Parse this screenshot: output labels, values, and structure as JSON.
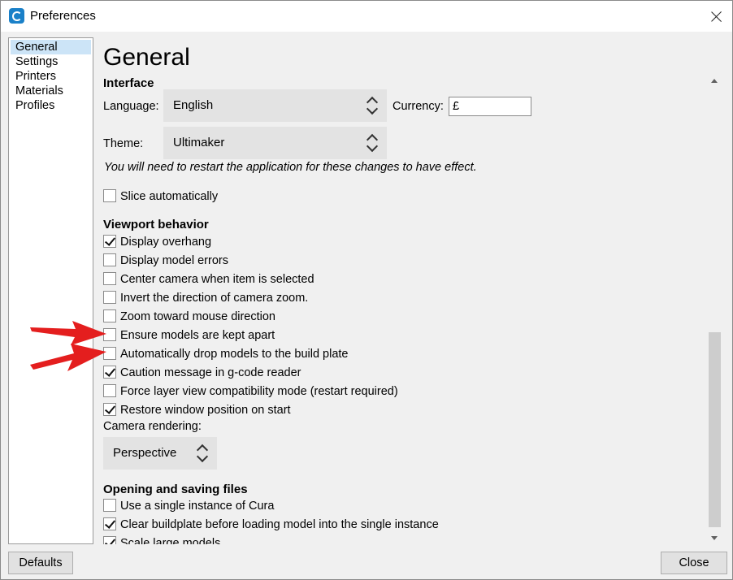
{
  "window": {
    "title": "Preferences"
  },
  "sidebar": {
    "items": [
      {
        "label": "General"
      },
      {
        "label": "Settings"
      },
      {
        "label": "Printers"
      },
      {
        "label": "Materials"
      },
      {
        "label": "Profiles"
      }
    ]
  },
  "general": {
    "heading": "General",
    "interface": {
      "section_label": "Interface",
      "language_label": "Language:",
      "language_value": "English",
      "currency_label": "Currency:",
      "currency_value": "£",
      "theme_label": "Theme:",
      "theme_value": "Ultimaker",
      "restart_note": "You will need to restart the application for these changes to have effect.",
      "slice_automatically": {
        "label": "Slice automatically",
        "checked": false
      }
    },
    "viewport": {
      "section_label": "Viewport behavior",
      "options": [
        {
          "label": "Display overhang",
          "checked": true
        },
        {
          "label": "Display model errors",
          "checked": false
        },
        {
          "label": "Center camera when item is selected",
          "checked": false
        },
        {
          "label": "Invert the direction of camera zoom.",
          "checked": false
        },
        {
          "label": "Zoom toward mouse direction",
          "checked": false
        },
        {
          "label": "Ensure models are kept apart",
          "checked": false
        },
        {
          "label": "Automatically drop models to the build plate",
          "checked": false
        },
        {
          "label": "Caution message in g-code reader",
          "checked": true
        },
        {
          "label": "Force layer view compatibility mode (restart required)",
          "checked": false
        },
        {
          "label": "Restore window position on start",
          "checked": true
        }
      ],
      "camera_rendering_label": "Camera rendering:",
      "camera_rendering_value": "Perspective"
    },
    "files": {
      "section_label": "Opening and saving files",
      "options": [
        {
          "label": "Use a single instance of Cura",
          "checked": false
        },
        {
          "label": "Clear buildplate before loading model into the single instance",
          "checked": true
        },
        {
          "label": "Scale large models",
          "checked": true
        }
      ]
    }
  },
  "footer": {
    "defaults_label": "Defaults",
    "close_label": "Close"
  },
  "annotations": {
    "arrow_color": "#e41e1e"
  },
  "icons": {
    "app": "cura-icon",
    "close": "close-icon"
  }
}
